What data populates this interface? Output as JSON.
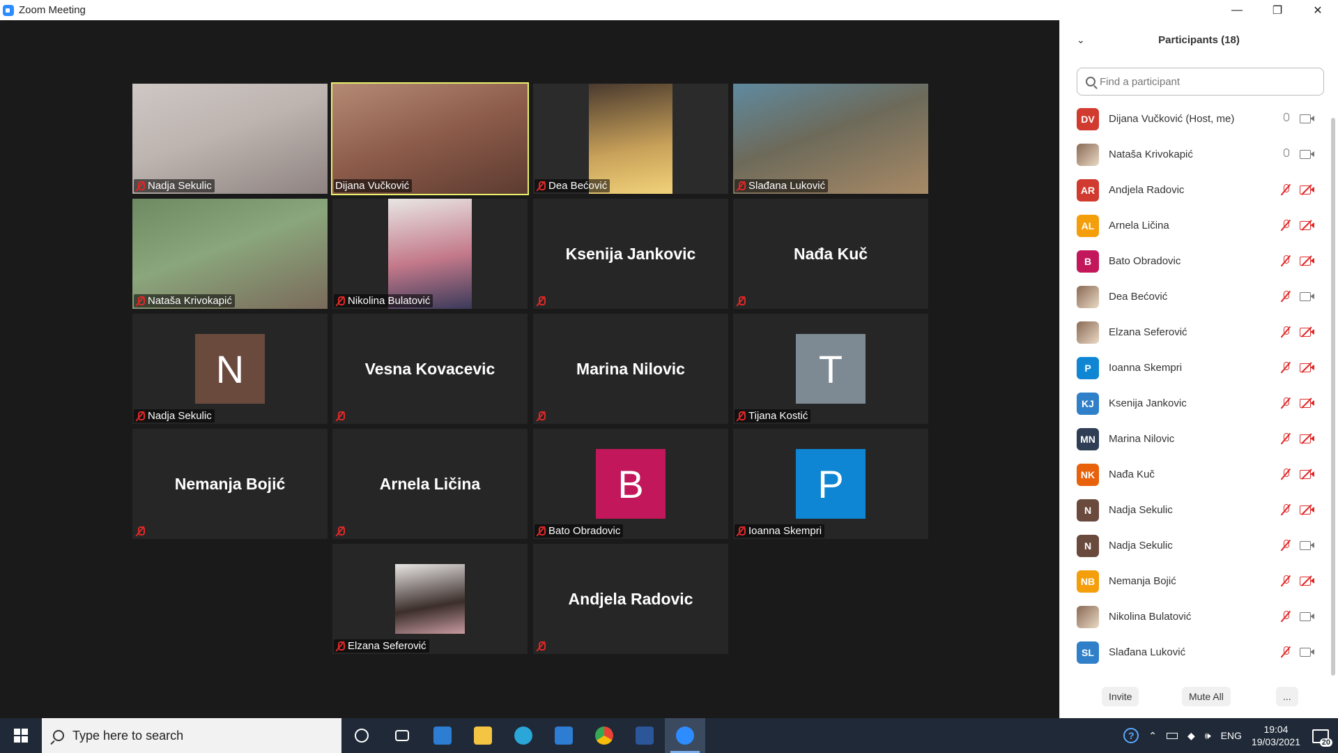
{
  "window": {
    "title": "Zoom Meeting",
    "controls": [
      "—",
      "❐",
      "✕"
    ]
  },
  "tiles": [
    {
      "kind": "video",
      "name": "Nadja Sekulic",
      "bg": "linear-gradient(160deg,#cfc7c4 0%,#bdb4b0 45%,#8e8380 100%)"
    },
    {
      "kind": "video",
      "name": "Dijana Vučković",
      "bg": "linear-gradient(160deg,#b48a74 0%,#8c5b4a 50%,#5c3b30 100%)",
      "active": true
    },
    {
      "kind": "video",
      "name": "Dea Bećović",
      "bg": "linear-gradient(180deg,#2b2b2b 0%,#2b2b2b 100%)",
      "inner": "linear-gradient(170deg,#4a3a2e 0%,#c9a25a 60%,#f1d27a 100%)"
    },
    {
      "kind": "video",
      "name": "Slađana Luković",
      "bg": "linear-gradient(160deg,#5f8aa0 0%,#6d6a5a 45%,#a88a66 100%)"
    },
    {
      "kind": "video",
      "name": "Nataša Krivokapić",
      "bg": "linear-gradient(160deg,#6e8a62 0%,#8aa67c 45%,#7a6a5a 100%)"
    },
    {
      "kind": "video",
      "name": "Nikolina Bulatović",
      "bg": "linear-gradient(180deg,#262626 0%,#262626 100%)",
      "inner": "linear-gradient(170deg,#e8e6e4 0%,#c3798a 55%,#3a3a5a 100%)"
    },
    {
      "kind": "name",
      "big": "Ksenija Jankovic"
    },
    {
      "kind": "name",
      "big": "Nađa Kuč"
    },
    {
      "kind": "avatar",
      "name": "Nadja Sekulic",
      "letter": "N",
      "color": "#6b4a3e"
    },
    {
      "kind": "name",
      "big": "Vesna Kovacevic"
    },
    {
      "kind": "name",
      "big": "Marina Nilovic"
    },
    {
      "kind": "avatar",
      "name": "Tijana Kostić",
      "letter": "T",
      "color": "#7d8a93"
    },
    {
      "kind": "name",
      "big": "Nemanja Bojić"
    },
    {
      "kind": "name",
      "big": "Arnela Ličina"
    },
    {
      "kind": "avatar",
      "name": "Bato Obradovic",
      "letter": "B",
      "color": "#c2185b"
    },
    {
      "kind": "avatar",
      "name": "Ioanna Skempri",
      "letter": "P",
      "color": "#0e86d4"
    },
    {
      "kind": "photo",
      "name": "Elzana Seferović",
      "color": "linear-gradient(170deg,#e9e6e4 0%,#3b2e2b 60%,#c89aa0 100%)"
    },
    {
      "kind": "name",
      "big": "Andjela Radovic"
    }
  ],
  "panel": {
    "title": "Participants (18)",
    "search_placeholder": "Find a participant",
    "participants": [
      {
        "initials": "DV",
        "color": "#d13b2f",
        "name": "Dijana Vučković (Host, me)",
        "mic": "on",
        "cam": "on"
      },
      {
        "initials": "",
        "photo": true,
        "name": "Nataša Krivokapić",
        "mic": "on",
        "cam": "on"
      },
      {
        "initials": "AR",
        "color": "#d13b2f",
        "name": "Andjela Radovic",
        "mic": "muted",
        "cam": "off"
      },
      {
        "initials": "AL",
        "color": "#f59e0b",
        "name": "Arnela Ličina",
        "mic": "muted",
        "cam": "off"
      },
      {
        "initials": "B",
        "color": "#c2185b",
        "name": "Bato Obradovic",
        "mic": "muted",
        "cam": "off"
      },
      {
        "initials": "",
        "photo": true,
        "name": "Dea Bećović",
        "mic": "muted",
        "cam": "on"
      },
      {
        "initials": "",
        "photo": true,
        "name": "Elzana Seferović",
        "mic": "muted",
        "cam": "off"
      },
      {
        "initials": "P",
        "color": "#0e86d4",
        "name": "Ioanna Skempri",
        "mic": "muted",
        "cam": "off"
      },
      {
        "initials": "KJ",
        "color": "#2f80c9",
        "name": "Ksenija Jankovic",
        "mic": "muted",
        "cam": "off"
      },
      {
        "initials": "MN",
        "color": "#2f3e55",
        "name": "Marina Nilovic",
        "mic": "muted",
        "cam": "off"
      },
      {
        "initials": "NK",
        "color": "#e8620c",
        "name": "Nađa Kuč",
        "mic": "muted",
        "cam": "off"
      },
      {
        "initials": "N",
        "color": "#6b4a3e",
        "name": "Nadja Sekulic",
        "mic": "muted",
        "cam": "off"
      },
      {
        "initials": "N",
        "color": "#6b4a3e",
        "name": "Nadja Sekulic",
        "mic": "muted",
        "cam": "on"
      },
      {
        "initials": "NB",
        "color": "#f59e0b",
        "name": "Nemanja Bojić",
        "mic": "muted",
        "cam": "off"
      },
      {
        "initials": "",
        "photo": true,
        "name": "Nikolina Bulatović",
        "mic": "muted",
        "cam": "on"
      },
      {
        "initials": "SL",
        "color": "#2f80c9",
        "name": "Slađana Luković",
        "mic": "muted",
        "cam": "on"
      }
    ],
    "footer": {
      "invite": "Invite",
      "mute_all": "Mute All",
      "more": "..."
    }
  },
  "taskbar": {
    "search_placeholder": "Type here to search",
    "apps": [
      {
        "name": "cortana",
        "color": "transparent"
      },
      {
        "name": "task-view",
        "color": "transparent"
      },
      {
        "name": "store",
        "color": "#2d7dd2"
      },
      {
        "name": "file-explorer",
        "color": "#f4c542"
      },
      {
        "name": "edge",
        "color": "#2aa6d8"
      },
      {
        "name": "mail",
        "color": "#2d7dd2"
      },
      {
        "name": "chrome",
        "color": "#e84335"
      },
      {
        "name": "word",
        "color": "#2b579a"
      },
      {
        "name": "zoom",
        "color": "#2d8cff",
        "active": true
      }
    ],
    "language": "ENG",
    "time": "19:04",
    "date": "19/03/2021",
    "notifications": "20"
  }
}
